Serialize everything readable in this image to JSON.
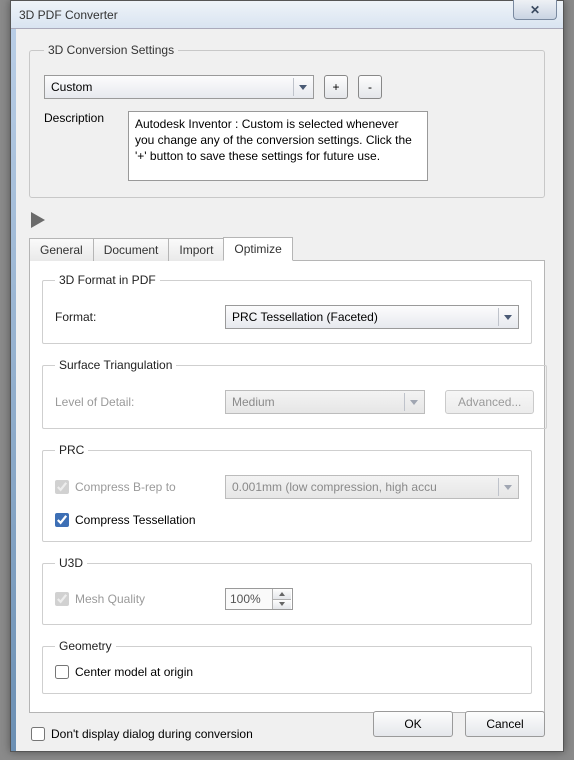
{
  "window": {
    "title": "3D PDF Converter"
  },
  "settings": {
    "legend": "3D Conversion Settings",
    "preset": "Custom",
    "plus": "+",
    "minus": "-",
    "description_label": "Description",
    "description": "Autodesk Inventor : Custom is selected whenever you change any of the conversion settings. Click the '+' button to save these settings for future use."
  },
  "tabs": {
    "general": "General",
    "document": "Document",
    "import": "Import",
    "optimize": "Optimize"
  },
  "optimize": {
    "format_group": "3D Format in PDF",
    "format_label": "Format:",
    "format_value": "PRC Tessellation (Faceted)",
    "surf_group": "Surface Triangulation",
    "lod_label": "Level of Detail:",
    "lod_value": "Medium",
    "advanced": "Advanced...",
    "prc_group": "PRC",
    "compress_brep_label": "Compress B-rep to",
    "compress_brep_value": "0.001mm (low compression, high accu",
    "compress_tess_label": "Compress Tessellation",
    "u3d_group": "U3D",
    "mesh_quality_label": "Mesh Quality",
    "mesh_quality_value": "100%",
    "geometry_group": "Geometry",
    "center_label": "Center model at origin"
  },
  "footer": {
    "dont_display": "Don't display dialog during conversion",
    "ok": "OK",
    "cancel": "Cancel"
  }
}
